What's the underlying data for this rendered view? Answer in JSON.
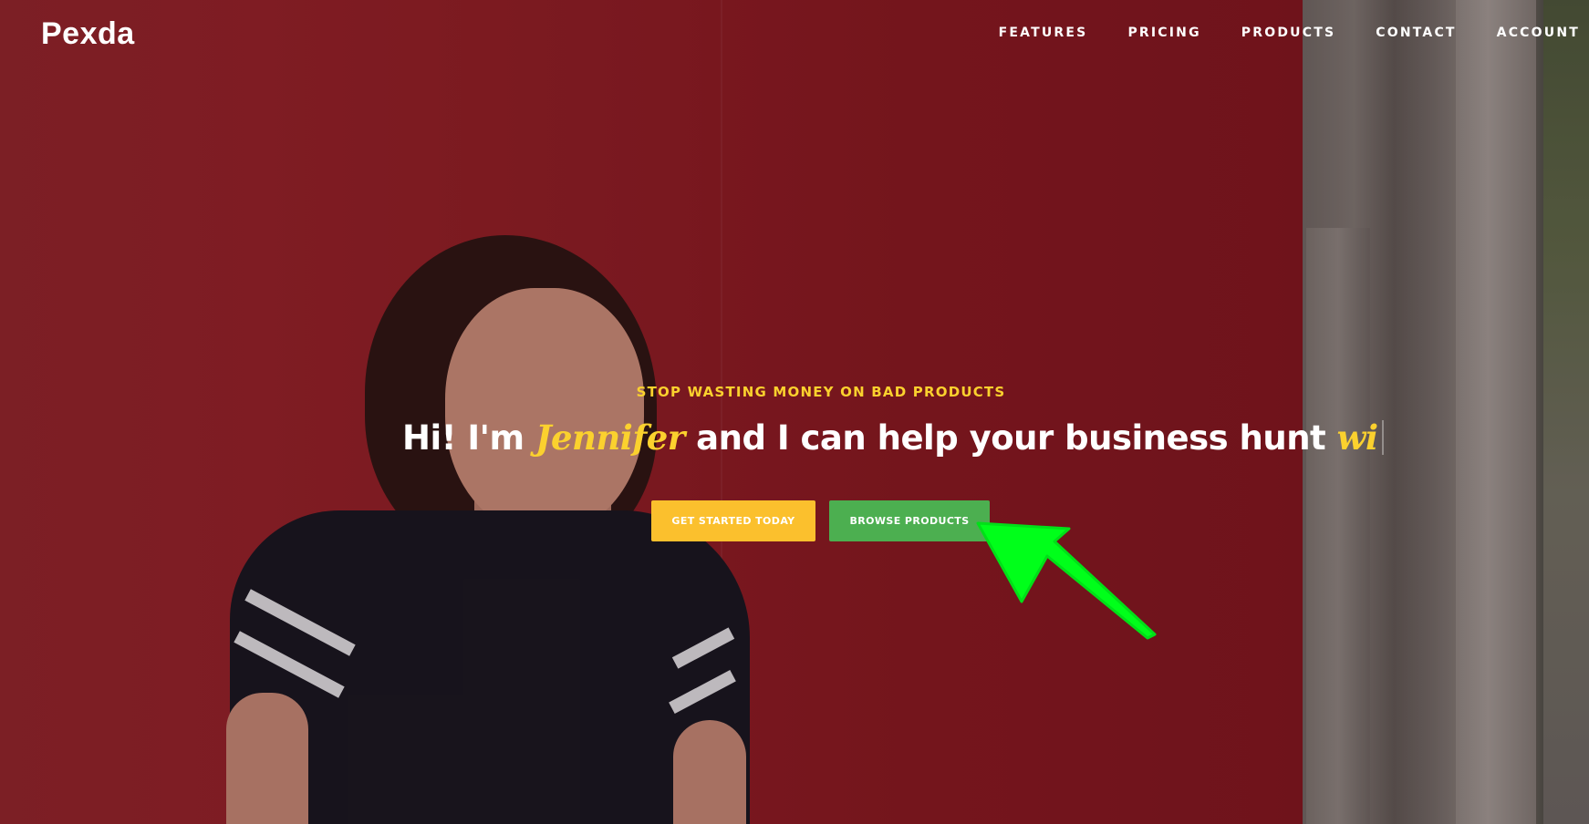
{
  "brand": {
    "name": "Pexda"
  },
  "nav": {
    "items": [
      "FEATURES",
      "PRICING",
      "PRODUCTS",
      "CONTACT",
      "ACCOUNT"
    ]
  },
  "hero": {
    "eyebrow": "STOP WASTING MONEY ON BAD PRODUCTS",
    "headline_pre": "Hi! I'm ",
    "headline_name": "Jennifer",
    "headline_mid": " and I can help your business hunt ",
    "headline_typed": "wi",
    "buttons": {
      "get_started": "GET STARTED TODAY",
      "browse": "BROWSE PRODUCTS"
    }
  },
  "colors": {
    "accent_yellow": "#fbd12e",
    "button_yellow": "#fbc02d",
    "button_green": "#4caf50",
    "arrow_green": "#00ff1a"
  }
}
